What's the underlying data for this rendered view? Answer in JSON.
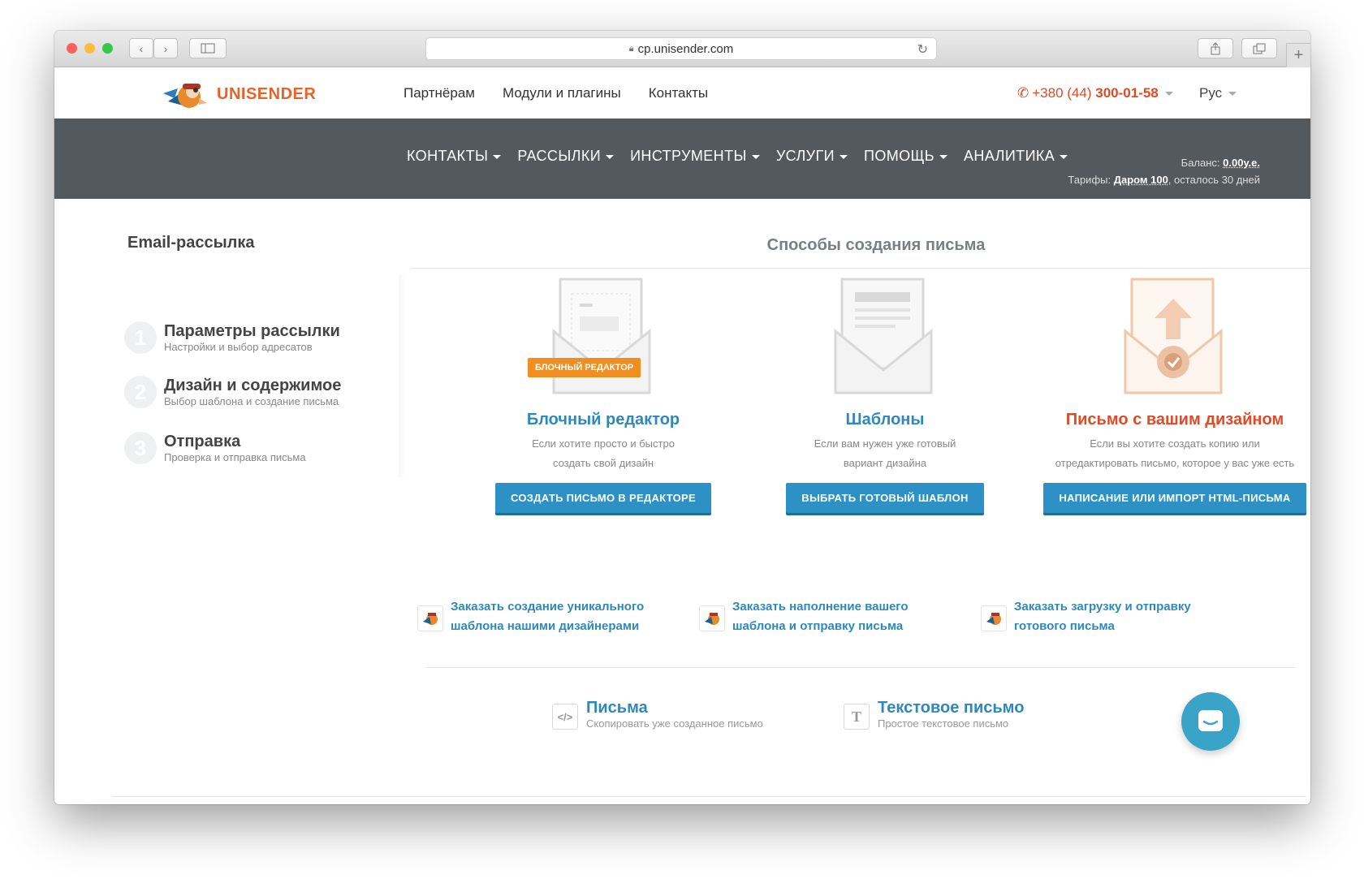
{
  "browser": {
    "url": "cp.unisender.com"
  },
  "brand": {
    "name": "UNISENDER"
  },
  "top_links": [
    "Партнёрам",
    "Модули и плагины",
    "Контакты"
  ],
  "phone": {
    "prefix": "+380 (44) ",
    "number": "300-01-58"
  },
  "lang": "Рус",
  "nav": [
    "КОНТАКТЫ",
    "РАССЫЛКИ",
    "ИНСТРУМЕНТЫ",
    "УСЛУГИ",
    "ПОМОЩЬ",
    "АНАЛИТИКА"
  ],
  "balance": {
    "label": "Баланс: ",
    "value": "0.00у.е.",
    "tariff_label": "Тарифы: ",
    "tariff": "Даром 100",
    "rest": ", осталось 30 дней"
  },
  "sidebar": {
    "title": "Email-рассылка",
    "steps": [
      {
        "num": "1",
        "title": "Параметры рассылки",
        "sub": "Настройки и выбор адресатов"
      },
      {
        "num": "2",
        "title": "Дизайн и содержимое",
        "sub": "Выбор шаблона и создание письма"
      },
      {
        "num": "3",
        "title": "Отправка",
        "sub": "Проверка и отправка письма"
      }
    ]
  },
  "main": {
    "title": "Способы создания письма",
    "options": [
      {
        "badge": "БЛОЧНЫЙ РЕДАКТОР",
        "title": "Блочный редактор",
        "desc1": "Если хотите просто и быстро",
        "desc2": "создать свой дизайн",
        "button": "СОЗДАТЬ ПИСЬМО В РЕДАКТОРЕ"
      },
      {
        "title": "Шаблоны",
        "desc1": "Если вам нужен уже готовый",
        "desc2": "вариант дизайна",
        "button": "ВЫБРАТЬ ГОТОВЫЙ ШАБЛОН"
      },
      {
        "title": "Письмо с вашим дизайном",
        "desc1": "Если вы хотите создать копию или",
        "desc2": "отредактировать письмо, которое у вас уже есть",
        "button": "НАПИСАНИЕ ИЛИ ИМПОРТ HTML-ПИСЬМА"
      }
    ],
    "orders": [
      {
        "l1": "Заказать создание уникального",
        "l2": "шаблона нашими дизайнерами"
      },
      {
        "l1": "Заказать наполнение вашего",
        "l2": "шаблона и отправку письма"
      },
      {
        "l1": "Заказать загрузку и отправку",
        "l2": "готового письма"
      }
    ],
    "alts": [
      {
        "title": "Письма",
        "sub": "Скопировать уже созданное письмо",
        "icon": "code-icon"
      },
      {
        "title": "Текстовое письмо",
        "sub": "Простое текстовое письмо",
        "icon": "text-icon",
        "glyph": "T"
      }
    ]
  },
  "colors": {
    "accent": "#2e91c6",
    "orange": "#e8622b",
    "nav_bg": "#53595c"
  }
}
